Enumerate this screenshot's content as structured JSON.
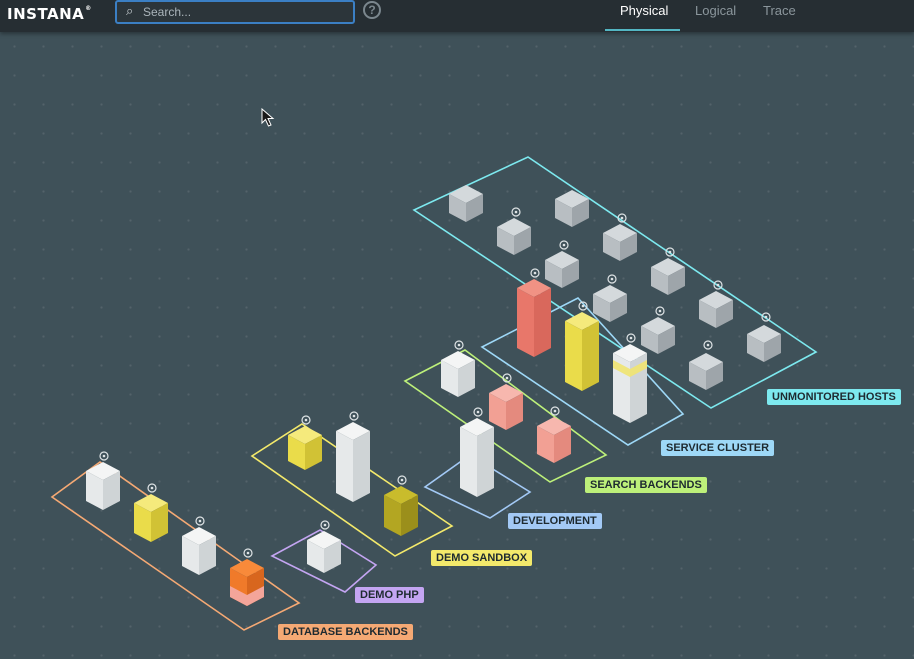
{
  "app": {
    "logo": "INSTANA"
  },
  "search": {
    "placeholder": "Search...",
    "value": ""
  },
  "help": {
    "label": "?"
  },
  "tabs": [
    {
      "label": "Physical",
      "active": true
    },
    {
      "label": "Logical",
      "active": false
    },
    {
      "label": "Trace",
      "active": false
    }
  ],
  "zones": [
    {
      "label": "UNMONITORED HOSTS",
      "color": "#7de9ef"
    },
    {
      "label": "SERVICE CLUSTER",
      "color": "#9ed8f7"
    },
    {
      "label": "SEARCH BACKENDS",
      "color": "#bdf07a"
    },
    {
      "label": "DEVELOPMENT",
      "color": "#a3c9f5"
    },
    {
      "label": "DEMO SANDBOX",
      "color": "#f3e96b"
    },
    {
      "label": "DEMO PHP",
      "color": "#c4a5f2"
    },
    {
      "label": "DATABASE BACKENDS",
      "color": "#f5a974"
    }
  ],
  "icons": {
    "search": "search-icon",
    "help": "help-icon",
    "cursor": "mouse-cursor-icon",
    "host": "host-block-icon",
    "agent": "agent-marker-icon"
  }
}
